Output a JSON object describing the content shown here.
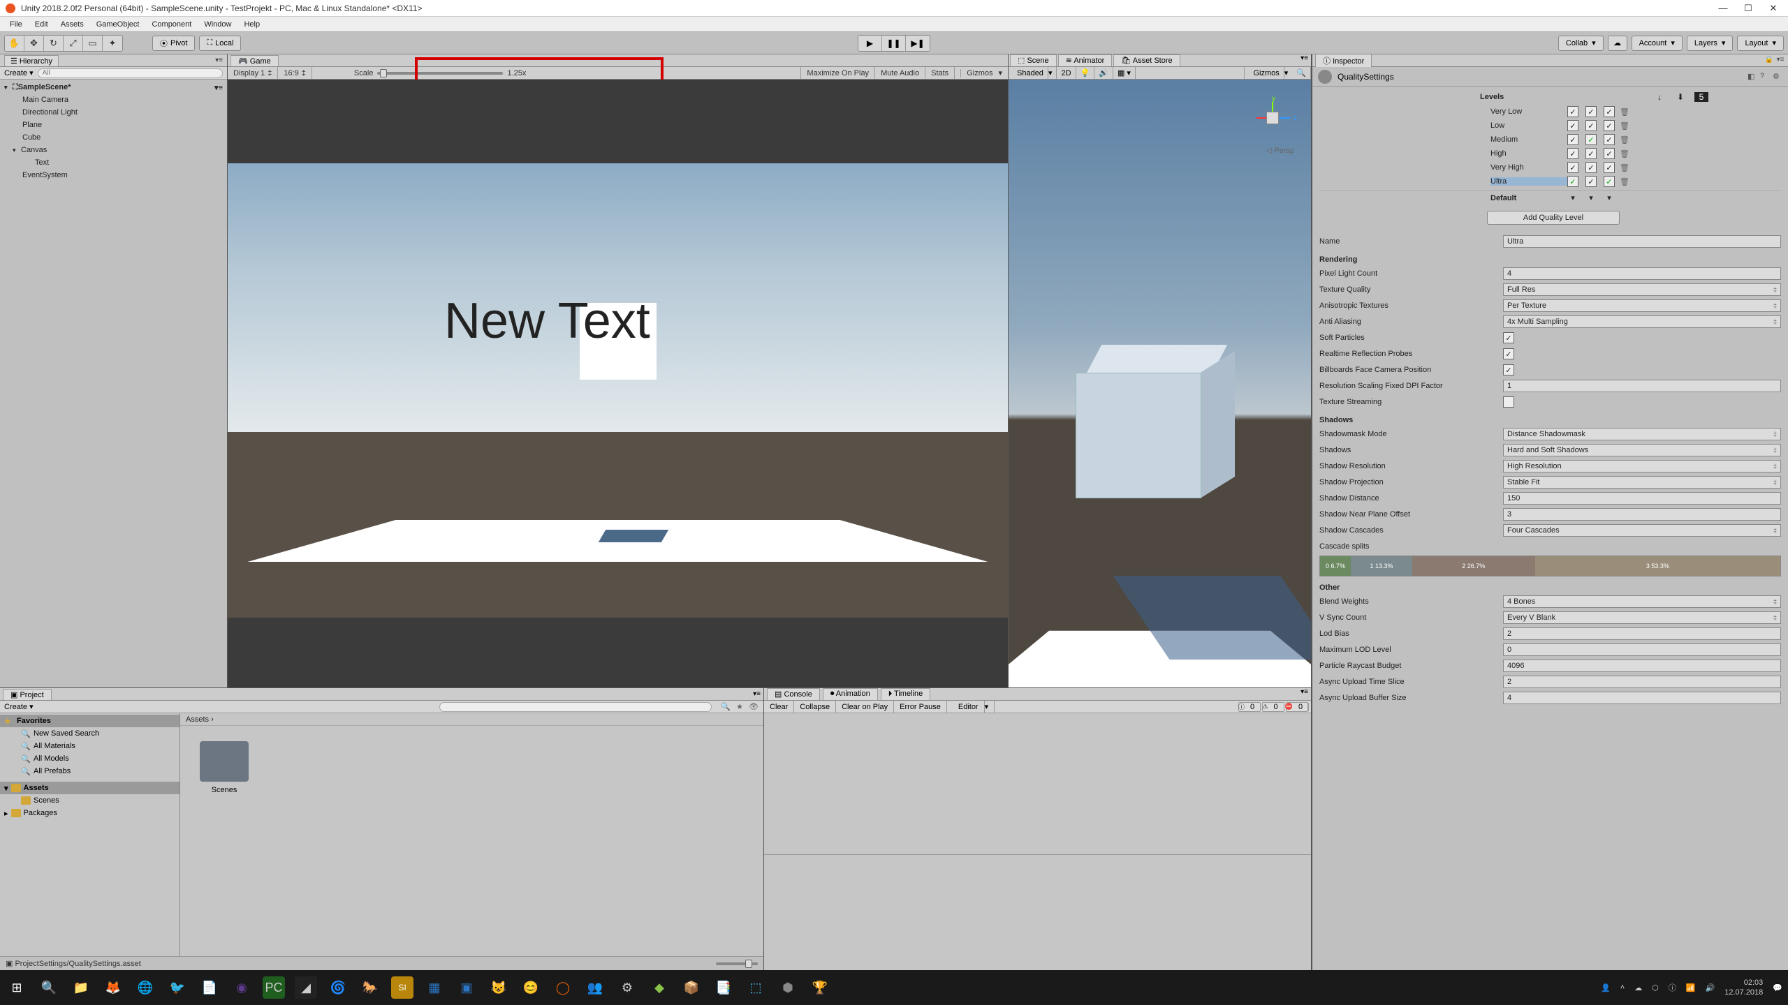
{
  "window": {
    "title": "Unity 2018.2.0f2 Personal (64bit) - SampleScene.unity - TestProjekt - PC, Mac & Linux Standalone* <DX11>"
  },
  "menu": [
    "File",
    "Edit",
    "Assets",
    "GameObject",
    "Component",
    "Window",
    "Help"
  ],
  "toolbar": {
    "pivot": "Pivot",
    "local": "Local",
    "collab": "Collab",
    "account": "Account",
    "layers": "Layers",
    "layout": "Layout"
  },
  "hierarchy": {
    "title": "Hierarchy",
    "create": "Create",
    "search_ph": "All",
    "scene": "SampleScene*",
    "items": [
      "Main Camera",
      "Directional Light",
      "Plane",
      "Cube",
      "Canvas",
      "Text",
      "EventSystem"
    ]
  },
  "game": {
    "tab": "Game",
    "display": "Display 1",
    "aspect": "16:9",
    "scale_label": "Scale",
    "scale_value": "1.25x",
    "max_on_play": "Maximize On Play",
    "mute": "Mute Audio",
    "stats": "Stats",
    "gizmos": "Gizmos",
    "overlay_text": "New Text"
  },
  "scene": {
    "tabs": [
      "Scene",
      "Animator",
      "Asset Store"
    ],
    "shaded": "Shaded",
    "mode2d": "2D",
    "gizmos": "Gizmos",
    "persp": "Persp"
  },
  "inspector": {
    "tab": "Inspector",
    "asset": "QualitySettings",
    "levels_title": "Levels",
    "levels": [
      "Very Low",
      "Low",
      "Medium",
      "High",
      "Very High",
      "Ultra"
    ],
    "default": "Default",
    "add": "Add Quality Level",
    "name_label": "Name",
    "name_value": "Ultra",
    "rendering": {
      "title": "Rendering",
      "pixel_light": "Pixel Light Count",
      "pixel_light_v": "4",
      "tex_q": "Texture Quality",
      "tex_q_v": "Full Res",
      "aniso": "Anisotropic Textures",
      "aniso_v": "Per Texture",
      "aa": "Anti Aliasing",
      "aa_v": "4x Multi Sampling",
      "soft": "Soft Particles",
      "refl": "Realtime Reflection Probes",
      "bill": "Billboards Face Camera Position",
      "res_scale": "Resolution Scaling Fixed DPI Factor",
      "res_scale_v": "1",
      "texstream": "Texture Streaming"
    },
    "shadows": {
      "title": "Shadows",
      "mask": "Shadowmask Mode",
      "mask_v": "Distance Shadowmask",
      "sh": "Shadows",
      "sh_v": "Hard and Soft Shadows",
      "res": "Shadow Resolution",
      "res_v": "High Resolution",
      "proj": "Shadow Projection",
      "proj_v": "Stable Fit",
      "dist": "Shadow Distance",
      "dist_v": "150",
      "near": "Shadow Near Plane Offset",
      "near_v": "3",
      "casc": "Shadow Cascades",
      "casc_v": "Four Cascades",
      "splits": "Cascade splits",
      "c": [
        "0\n6.7%",
        "1\n13.3%",
        "2\n26.7%",
        "3\n53.3%"
      ]
    },
    "other": {
      "title": "Other",
      "blend": "Blend Weights",
      "blend_v": "4 Bones",
      "vsync": "V Sync Count",
      "vsync_v": "Every V Blank",
      "lod": "Lod Bias",
      "lod_v": "2",
      "maxlod": "Maximum LOD Level",
      "maxlod_v": "0",
      "ray": "Particle Raycast Budget",
      "ray_v": "4096",
      "upslice": "Async Upload Time Slice",
      "upslice_v": "2",
      "upbuf": "Async Upload Buffer Size",
      "upbuf_v": "4"
    }
  },
  "project": {
    "tab": "Project",
    "create": "Create",
    "favorites": "Favorites",
    "fav_items": [
      "New Saved Search",
      "All Materials",
      "All Models",
      "All Prefabs"
    ],
    "assets": "Assets",
    "scenes": "Scenes",
    "packages": "Packages",
    "crumb": "Assets ›",
    "folder": "Scenes",
    "status": "ProjectSettings/QualitySettings.asset"
  },
  "console": {
    "tabs": [
      "Console",
      "Animation",
      "Timeline"
    ],
    "buttons": [
      "Clear",
      "Collapse",
      "Clear on Play",
      "Error Pause",
      "Editor"
    ],
    "counts": [
      "0",
      "0",
      "0"
    ]
  },
  "taskbar": {
    "time": "02:03",
    "date": "12.07.2018"
  }
}
